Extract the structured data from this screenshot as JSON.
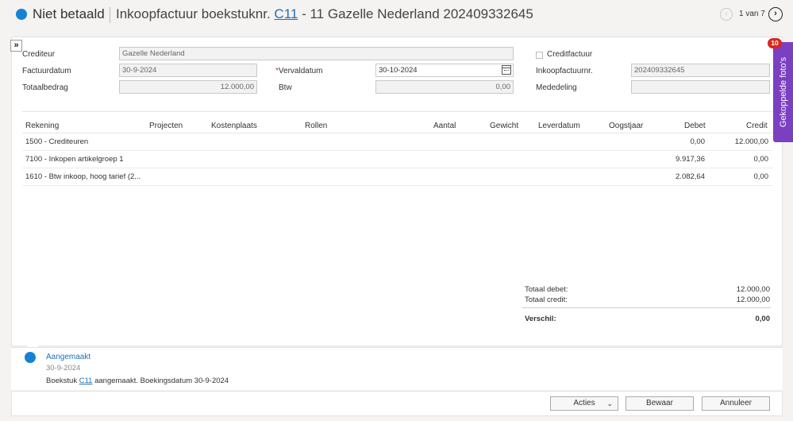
{
  "header": {
    "status": "Niet betaald",
    "title_prefix": "Inkoopfactuur boekstuknr.",
    "doc_link": "C11",
    "title_suffix": "- 11 Gazelle Nederland 202409332645",
    "pager": "1 van 7",
    "prev_icon": "chevron-left-icon",
    "next_icon": "chevron-right-icon"
  },
  "expand_label": "»",
  "form": {
    "crediteur_label": "Crediteur",
    "crediteur_value": "Gazelle Nederland",
    "creditfactuur_label": "Creditfactuur",
    "factuurdatum_label": "Factuurdatum",
    "factuurdatum_value": "30-9-2024",
    "vervaldatum_required": "*",
    "vervaldatum_label": "Vervaldatum",
    "vervaldatum_value": "30-10-2024",
    "inkoopfactuurnr_label": "Inkoopfactuurnr.",
    "inkoopfactuurnr_value": "202409332645",
    "totaalbedrag_label": "Totaalbedrag",
    "totaalbedrag_value": "12.000,00",
    "btw_label": "Btw",
    "btw_value": "0,00",
    "mededeling_label": "Mededeling",
    "mededeling_value": ""
  },
  "side_tab": {
    "label": "Gekoppelde foto's",
    "badge": "10"
  },
  "table": {
    "headers": [
      "Rekening",
      "Projecten",
      "Kostenplaats",
      "Rollen",
      "Aantal",
      "Gewicht",
      "Leverdatum",
      "Oogstjaar",
      "Debet",
      "Credit"
    ],
    "rows": [
      {
        "rekening": "1500  -  Crediteuren",
        "debet": "0,00",
        "credit": "12.000,00"
      },
      {
        "rekening": "7100  -  Inkopen artikelgroep 1",
        "debet": "9.917,36",
        "credit": "0,00"
      },
      {
        "rekening": "1610  -  Btw inkoop, hoog tarief (2...",
        "debet": "2.082,64",
        "credit": "0,00"
      }
    ]
  },
  "totals": {
    "debet_label": "Totaal debet:",
    "debet_value": "12.000,00",
    "credit_label": "Totaal credit:",
    "credit_value": "12.000,00",
    "verschil_label": "Verschil:",
    "verschil_value": "0,00"
  },
  "activity": {
    "title": "Aangemaakt",
    "date": "30-9-2024",
    "msg_prefix": "Boekstuk",
    "msg_link": "C11",
    "msg_suffix": "aangemaakt. Boekingsdatum 30-9-2024"
  },
  "buttons": {
    "acties": "Acties",
    "bewaar": "Bewaar",
    "annuleer": "Annuleer"
  },
  "colors": {
    "accent": "#1583d2",
    "side_tab": "#7b3fc2",
    "badge": "#d9281e"
  }
}
